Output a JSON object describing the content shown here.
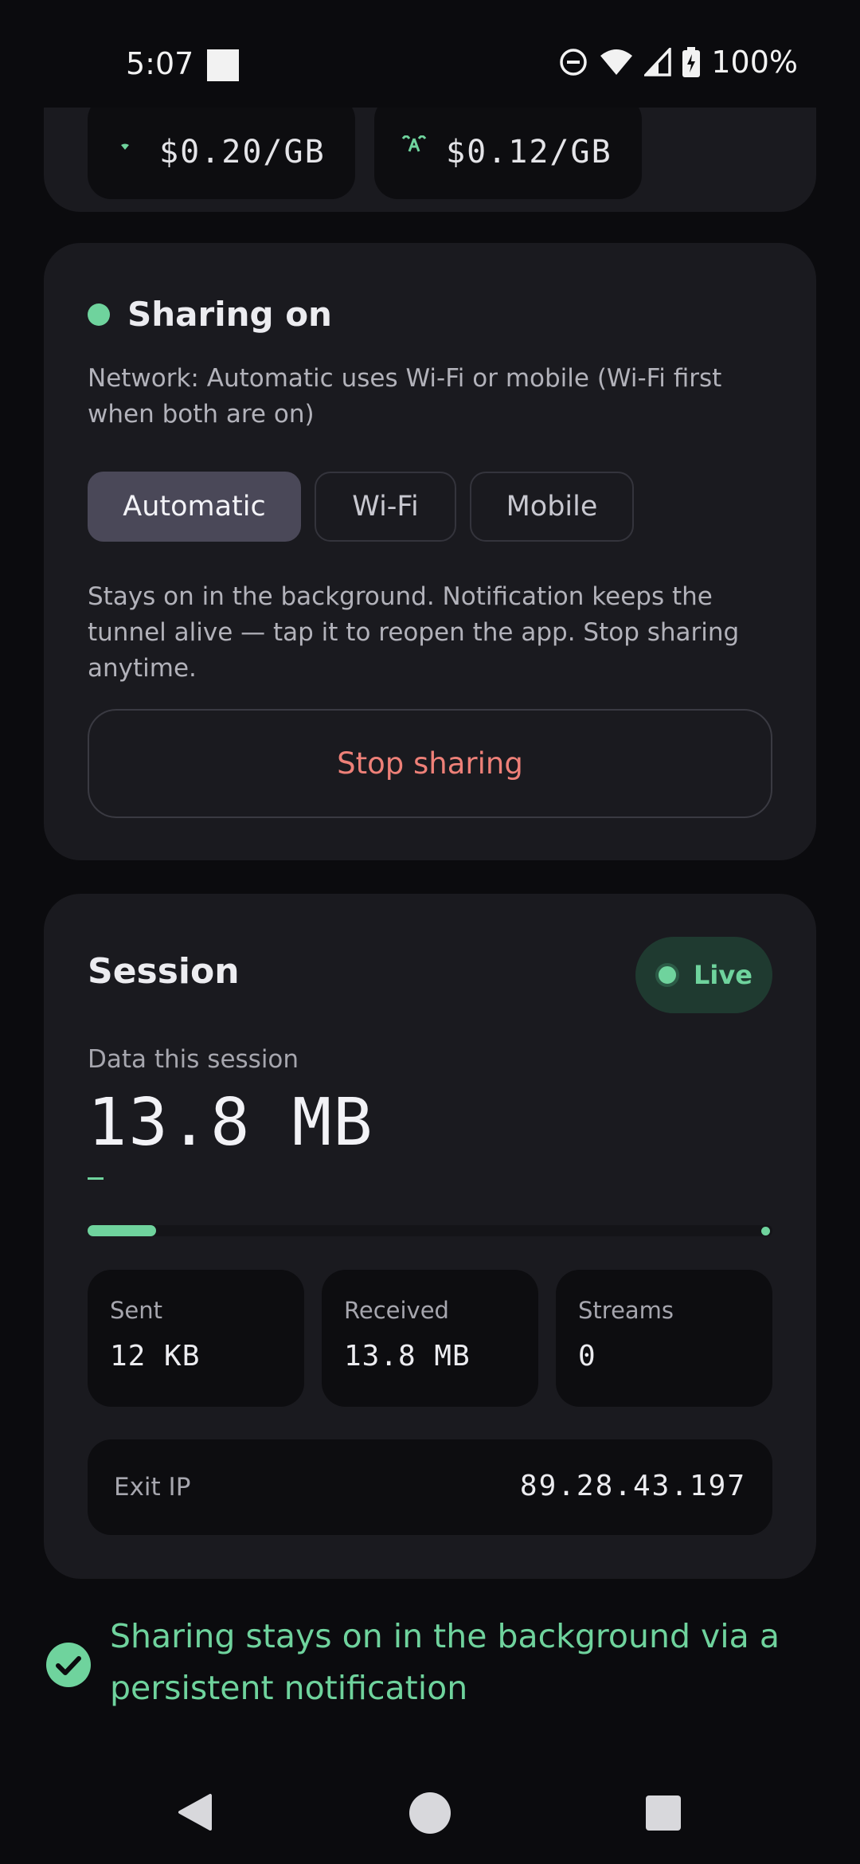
{
  "status_bar": {
    "time": "5:07",
    "battery": "100%",
    "icons": [
      "dnd-icon",
      "wifi-icon",
      "signal-icon",
      "battery-icon"
    ]
  },
  "pricing": {
    "chips": [
      {
        "icon": "wifi-icon",
        "value": "$0.20/GB"
      },
      {
        "icon": "antenna-icon",
        "value": "$0.12/GB"
      }
    ]
  },
  "sharing": {
    "title": "Sharing on",
    "network_note": "Network: Automatic uses Wi-Fi or mobile (Wi-Fi first when both are on)",
    "network_options": [
      "Automatic",
      "Wi-Fi",
      "Mobile"
    ],
    "selected_network": "Automatic",
    "background_note": "Stays on in the background. Notification keeps the tunnel alive — tap it to reopen the app. Stop sharing anytime.",
    "stop_label": "Stop sharing"
  },
  "session": {
    "title": "Session",
    "badge": "Live",
    "data_label": "Data this session",
    "data_value": "13.8 MB",
    "progress_fraction": 0.1,
    "stats": [
      {
        "label": "Sent",
        "value": "12 KB"
      },
      {
        "label": "Received",
        "value": "13.8 MB"
      },
      {
        "label": "Streams",
        "value": "0"
      }
    ],
    "exit_ip_label": "Exit IP",
    "exit_ip_value": "89.28.43.197"
  },
  "background_status": {
    "text": "Sharing stays on in the background via a persistent notification"
  },
  "colors": {
    "accent_green": "#6fd39d",
    "stop_red": "#ee8078",
    "card_bg": "#1a1a1f",
    "page_bg": "#0b0b0e"
  }
}
